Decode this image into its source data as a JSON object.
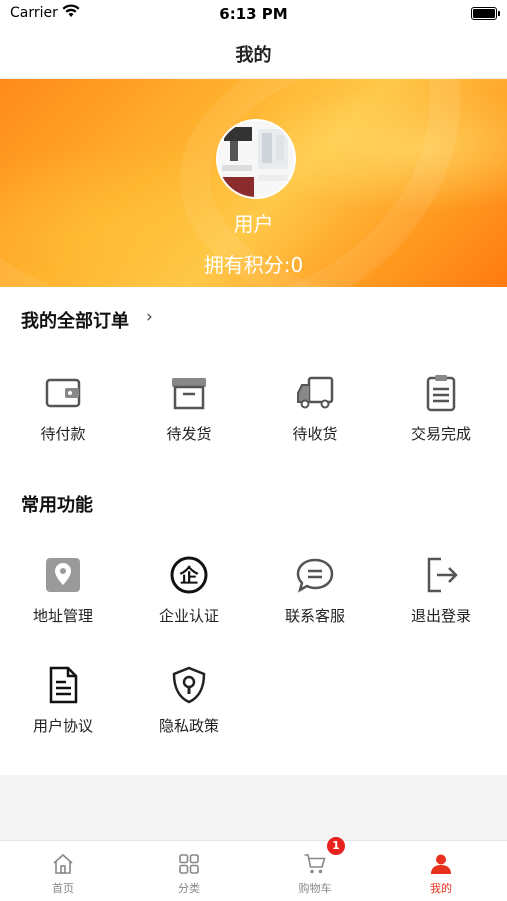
{
  "status_bar": {
    "carrier": "Carrier",
    "time": "6:13 PM"
  },
  "nav": {
    "title": "我的"
  },
  "profile": {
    "username": "用户",
    "points_text": "拥有积分:0"
  },
  "orders": {
    "title": "我的全部订单",
    "items": [
      {
        "label": "待付款",
        "icon": "wallet-icon"
      },
      {
        "label": "待发货",
        "icon": "box-icon"
      },
      {
        "label": "待收货",
        "icon": "truck-icon"
      },
      {
        "label": "交易完成",
        "icon": "clipboard-icon"
      }
    ]
  },
  "functions": {
    "title": "常用功能",
    "items": [
      {
        "label": "地址管理",
        "icon": "location-pin-icon"
      },
      {
        "label": "企业认证",
        "icon": "enterprise-badge-icon"
      },
      {
        "label": "联系客服",
        "icon": "chat-bubble-icon"
      },
      {
        "label": "退出登录",
        "icon": "logout-icon"
      },
      {
        "label": "用户协议",
        "icon": "document-icon"
      },
      {
        "label": "隐私政策",
        "icon": "shield-lock-icon"
      }
    ]
  },
  "tabbar": {
    "items": [
      {
        "label": "首页",
        "icon": "home-icon"
      },
      {
        "label": "分类",
        "icon": "category-grid-icon"
      },
      {
        "label": "购物车",
        "icon": "cart-icon",
        "badge": "1"
      },
      {
        "label": "我的",
        "icon": "person-icon",
        "active": true
      }
    ]
  },
  "colors": {
    "accent": "#e8321e",
    "hero_orange": "#ff9a1f",
    "badge": "#e8221e"
  }
}
